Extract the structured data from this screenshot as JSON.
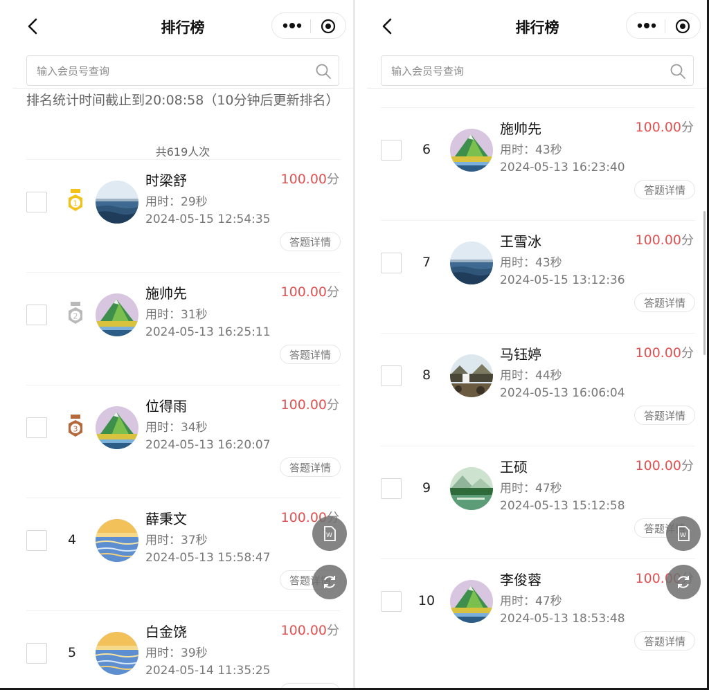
{
  "nav": {
    "title": "排行榜"
  },
  "search": {
    "placeholder": "输入会员号查询"
  },
  "notice": "排名统计时间截止到20:08:58（10分钟后更新排名）",
  "total": "共619人次",
  "colors": {
    "score": "#e05252",
    "gold": "#f2c21b",
    "silver": "#b9b9b9",
    "bronze": "#b5683a"
  },
  "detail_label": "答题详情",
  "score_unit": "分",
  "left_entries": [
    {
      "rank": "1",
      "medal": "gold-medal-icon",
      "avatar": "sea-avatar",
      "name": "时梁舒",
      "used": "用时：29秒",
      "time": "2024-05-15 12:54:35",
      "score": "100.00"
    },
    {
      "rank": "2",
      "medal": "silver-medal-icon",
      "avatar": "mountain-avatar",
      "name": "施帅先",
      "used": "用时：31秒",
      "time": "2024-05-13 16:25:11",
      "score": "100.00"
    },
    {
      "rank": "3",
      "medal": "bronze-medal-icon",
      "avatar": "mountain-avatar",
      "name": "位得雨",
      "used": "用时：34秒",
      "time": "2024-05-13 16:20:07",
      "score": "100.00"
    },
    {
      "rank": "4",
      "avatar": "sunset-avatar",
      "name": "薛秉文",
      "used": "用时：37秒",
      "time": "2024-05-13 15:58:47",
      "score": "100.00"
    },
    {
      "rank": "5",
      "avatar": "sunset-avatar",
      "name": "白金饶",
      "used": "用时：39秒",
      "time": "2024-05-14 11:35:25",
      "score": "100.00"
    }
  ],
  "right_entries": [
    {
      "rank": "6",
      "avatar": "mountain-avatar",
      "name": "施帅先",
      "used": "用时：43秒",
      "time": "2024-05-13 16:23:40",
      "score": "100.00"
    },
    {
      "rank": "7",
      "avatar": "sea-avatar",
      "name": "王雪冰",
      "used": "用时：43秒",
      "time": "2024-05-15 13:12:36",
      "score": "100.00"
    },
    {
      "rank": "8",
      "avatar": "waterfall-avatar",
      "name": "马钰婷",
      "used": "用时：44秒",
      "time": "2024-05-13 16:06:04",
      "score": "100.00"
    },
    {
      "rank": "9",
      "avatar": "lake-avatar",
      "name": "王硕",
      "used": "用时：47秒",
      "time": "2024-05-13 15:12:58",
      "score": "100.00"
    },
    {
      "rank": "10",
      "avatar": "mountain-avatar",
      "name": "李俊蓉",
      "used": "用时：47秒",
      "time": "2024-05-13 18:53:48",
      "score": "100.00"
    }
  ]
}
